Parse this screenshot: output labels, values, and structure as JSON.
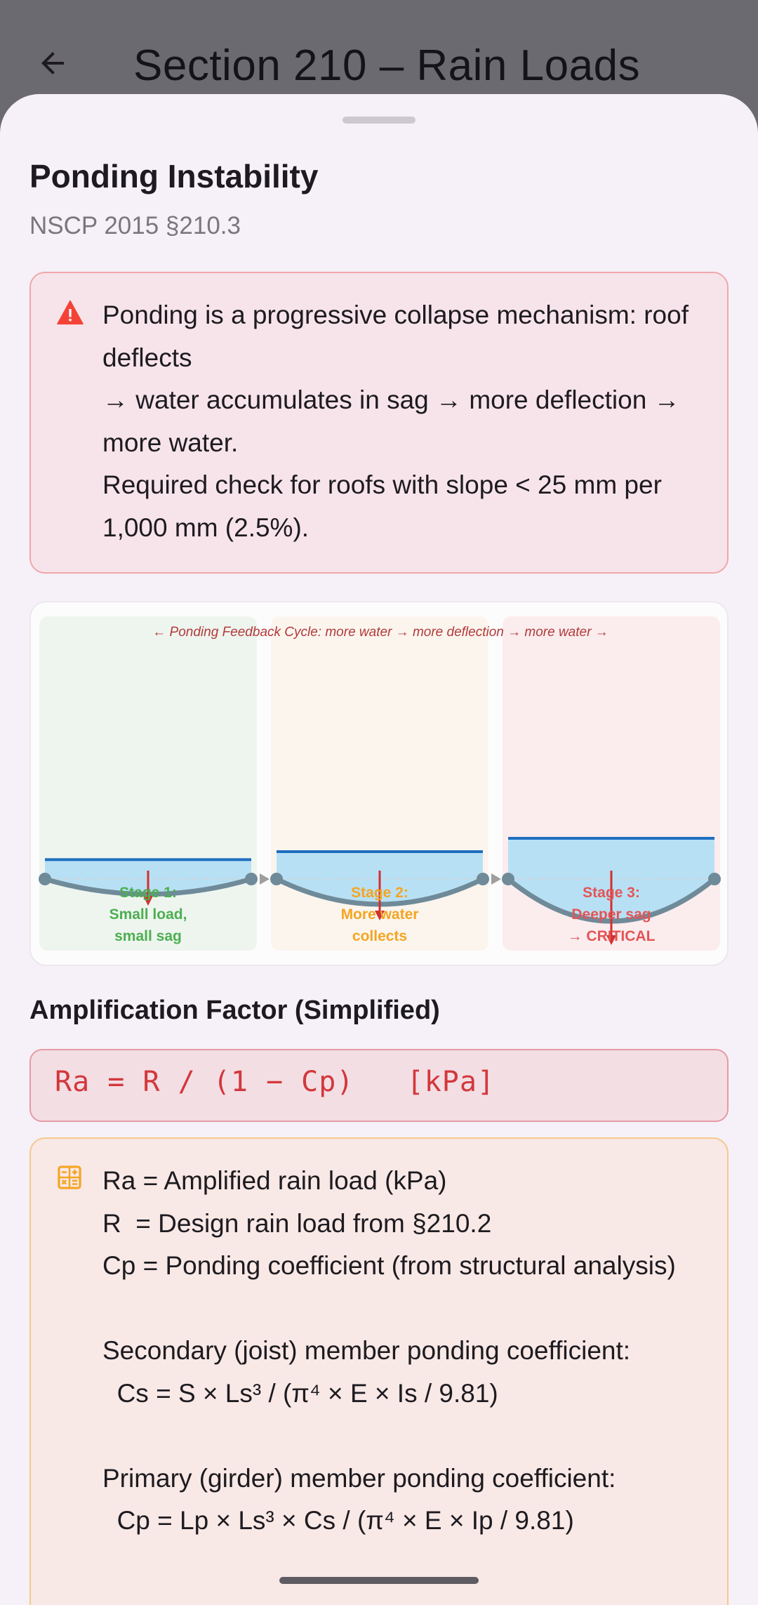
{
  "app_bar": {
    "title": "Section 210 – Rain Loads",
    "back_icon": "arrow-back-icon"
  },
  "sheet": {
    "title": "Ponding Instability",
    "subtitle": "NSCP 2015 §210.3"
  },
  "warning": {
    "icon": "warning-triangle-icon",
    "color": "#f44336",
    "lines": [
      "Ponding is a progressive collapse mechanism: roof deflects",
      "→ water accumulates in sag → more deflection → more water.",
      "Required check for roofs with slope < 25 mm per 1,000 mm (2.5%)."
    ]
  },
  "diagram": {
    "caption": "← Ponding Feedback Cycle: more water → more deflection → more water →",
    "stages": [
      {
        "line1": "Stage 1:",
        "line2": "Small load,",
        "line3": "small sag",
        "color": "#4caf50",
        "bg": "#eef5ef",
        "sag": 0.2
      },
      {
        "line1": "Stage 2:",
        "line2": "More water",
        "line3": "collects",
        "color": "#f4a522",
        "bg": "#fbf5ee",
        "sag": 0.5
      },
      {
        "line1": "Stage 3:",
        "line2": "Deeper sag",
        "line3": "→ CRITICAL",
        "color": "#e45555",
        "bg": "#fbecee",
        "sag": 1.0
      }
    ]
  },
  "amplification": {
    "heading": "Amplification Factor (Simplified)",
    "formula": "Ra = R / (1 − Cp)   [kPa]"
  },
  "variables": {
    "icon": "calculator-icon",
    "text": "Ra = Amplified rain load (kPa)\nR  = Design rain load from §210.2\nCp = Ponding coefficient (from structural analysis)\n\nSecondary (joist) member ponding coefficient:\n  Cs = S × Ls³ / (π⁴ × E × Is / 9.81)\n\nPrimary (girder) member ponding coefficient:\n  Cp = Lp × Ls³ × Cs / (π⁴ × E × Ip / 9.81)"
  }
}
